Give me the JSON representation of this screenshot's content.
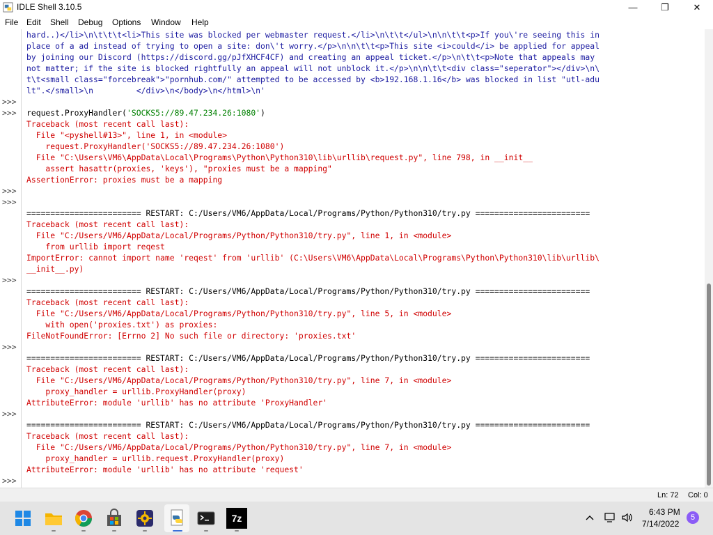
{
  "window": {
    "title": "IDLE Shell 3.10.5",
    "minimize": "—",
    "maximize": "❐",
    "close": "✕"
  },
  "menu": [
    "File",
    "Edit",
    "Shell",
    "Debug",
    "Options",
    "Window",
    "Help"
  ],
  "lines": [
    {
      "p": "",
      "t": "hard..)</li>\\n\\t\\t\\t<li>This site was blocked per webmaster request.</li>\\n\\t\\t</ul>\\n\\n\\t\\t<p>If you\\'re seeing this in",
      "c": "blue"
    },
    {
      "p": "",
      "t": "place of a ad instead of trying to open a site: don\\'t worry.</p>\\n\\n\\t\\t<p>This site <i>could</i> be applied for appeal",
      "c": "blue"
    },
    {
      "p": "",
      "t": "by joining our Discord (https://discord.gg/pJfXHCF4CF) and creating an appeal ticket.</p>\\n\\t\\t<p>Note that appeals may",
      "c": "blue"
    },
    {
      "p": "",
      "t": "not matter; if the site is blocked rightfully an appeal will not unblock it.</p>\\n\\n\\t\\t<div class=\"seperator\"></div>\\n\\",
      "c": "blue"
    },
    {
      "p": "",
      "t": "t\\t<small class=\"forcebreak\">\"pornhub.com/\" attempted to be accessed by <b>192.168.1.16</b> was blocked in list \"utl-adu",
      "c": "blue"
    },
    {
      "p": "",
      "t": "lt\".</small>\\n         </div>\\n</body>\\n</html>\\n'",
      "c": "blue"
    },
    {
      "p": ">>>",
      "t": "",
      "c": "black"
    },
    {
      "p": ">>>",
      "t": "request.ProxyHandler(",
      "c": "black",
      "t2": "'SOCKS5://89.47.234.26:1080'",
      "c2": "green",
      "t3": ")",
      "c3": "black"
    },
    {
      "p": "",
      "t": "Traceback (most recent call last):",
      "c": "red"
    },
    {
      "p": "",
      "t": "  File \"<pyshell#13>\", line 1, in <module>",
      "c": "red"
    },
    {
      "p": "",
      "t": "    request.ProxyHandler('SOCKS5://89.47.234.26:1080')",
      "c": "red"
    },
    {
      "p": "",
      "t": "  File \"C:\\Users\\VM6\\AppData\\Local\\Programs\\Python\\Python310\\lib\\urllib\\request.py\", line 798, in __init__",
      "c": "red"
    },
    {
      "p": "",
      "t": "    assert hasattr(proxies, 'keys'), \"proxies must be a mapping\"",
      "c": "red"
    },
    {
      "p": "",
      "t": "AssertionError: proxies must be a mapping",
      "c": "red"
    },
    {
      "p": ">>>",
      "t": "",
      "c": "black"
    },
    {
      "p": ">>>",
      "t": "",
      "c": "black"
    },
    {
      "p": "",
      "t": "======================== RESTART: C:/Users/VM6/AppData/Local/Programs/Python/Python310/try.py ========================",
      "c": "black"
    },
    {
      "p": "",
      "t": "Traceback (most recent call last):",
      "c": "red"
    },
    {
      "p": "",
      "t": "  File \"C:/Users/VM6/AppData/Local/Programs/Python/Python310/try.py\", line 1, in <module>",
      "c": "red"
    },
    {
      "p": "",
      "t": "    from urllib import reqest",
      "c": "red"
    },
    {
      "p": "",
      "t": "ImportError: cannot import name 'reqest' from 'urllib' (C:\\Users\\VM6\\AppData\\Local\\Programs\\Python\\Python310\\lib\\urllib\\",
      "c": "red"
    },
    {
      "p": "",
      "t": "__init__.py)",
      "c": "red"
    },
    {
      "p": ">>>",
      "t": "",
      "c": "black"
    },
    {
      "p": "",
      "t": "======================== RESTART: C:/Users/VM6/AppData/Local/Programs/Python/Python310/try.py ========================",
      "c": "black"
    },
    {
      "p": "",
      "t": "Traceback (most recent call last):",
      "c": "red"
    },
    {
      "p": "",
      "t": "  File \"C:/Users/VM6/AppData/Local/Programs/Python/Python310/try.py\", line 5, in <module>",
      "c": "red"
    },
    {
      "p": "",
      "t": "    with open('proxies.txt') as proxies:",
      "c": "red"
    },
    {
      "p": "",
      "t": "FileNotFoundError: [Errno 2] No such file or directory: 'proxies.txt'",
      "c": "red"
    },
    {
      "p": ">>>",
      "t": "",
      "c": "black"
    },
    {
      "p": "",
      "t": "======================== RESTART: C:/Users/VM6/AppData/Local/Programs/Python/Python310/try.py ========================",
      "c": "black"
    },
    {
      "p": "",
      "t": "Traceback (most recent call last):",
      "c": "red"
    },
    {
      "p": "",
      "t": "  File \"C:/Users/VM6/AppData/Local/Programs/Python/Python310/try.py\", line 7, in <module>",
      "c": "red"
    },
    {
      "p": "",
      "t": "    proxy_handler = urllib.ProxyHandler(proxy)",
      "c": "red"
    },
    {
      "p": "",
      "t": "AttributeError: module 'urllib' has no attribute 'ProxyHandler'",
      "c": "red"
    },
    {
      "p": ">>>",
      "t": "",
      "c": "black"
    },
    {
      "p": "",
      "t": "======================== RESTART: C:/Users/VM6/AppData/Local/Programs/Python/Python310/try.py ========================",
      "c": "black"
    },
    {
      "p": "",
      "t": "Traceback (most recent call last):",
      "c": "red"
    },
    {
      "p": "",
      "t": "  File \"C:/Users/VM6/AppData/Local/Programs/Python/Python310/try.py\", line 7, in <module>",
      "c": "red"
    },
    {
      "p": "",
      "t": "    proxy_handler = urllib.request.ProxyHandler(proxy)",
      "c": "red"
    },
    {
      "p": "",
      "t": "AttributeError: module 'urllib' has no attribute 'request'",
      "c": "red"
    },
    {
      "p": ">>>",
      "t": "",
      "c": "black"
    }
  ],
  "status": {
    "ln": "Ln: 72",
    "col": "Col: 0"
  },
  "taskbar": {
    "time": "6:43 PM",
    "date": "7/14/2022",
    "notification_count": "5",
    "icons": [
      "windows-start-icon",
      "file-explorer-icon",
      "chrome-icon",
      "microsoft-store-icon",
      "settings-icon",
      "python-idle-icon",
      "terminal-icon",
      "7zip-icon"
    ],
    "zip_label": "7z"
  }
}
